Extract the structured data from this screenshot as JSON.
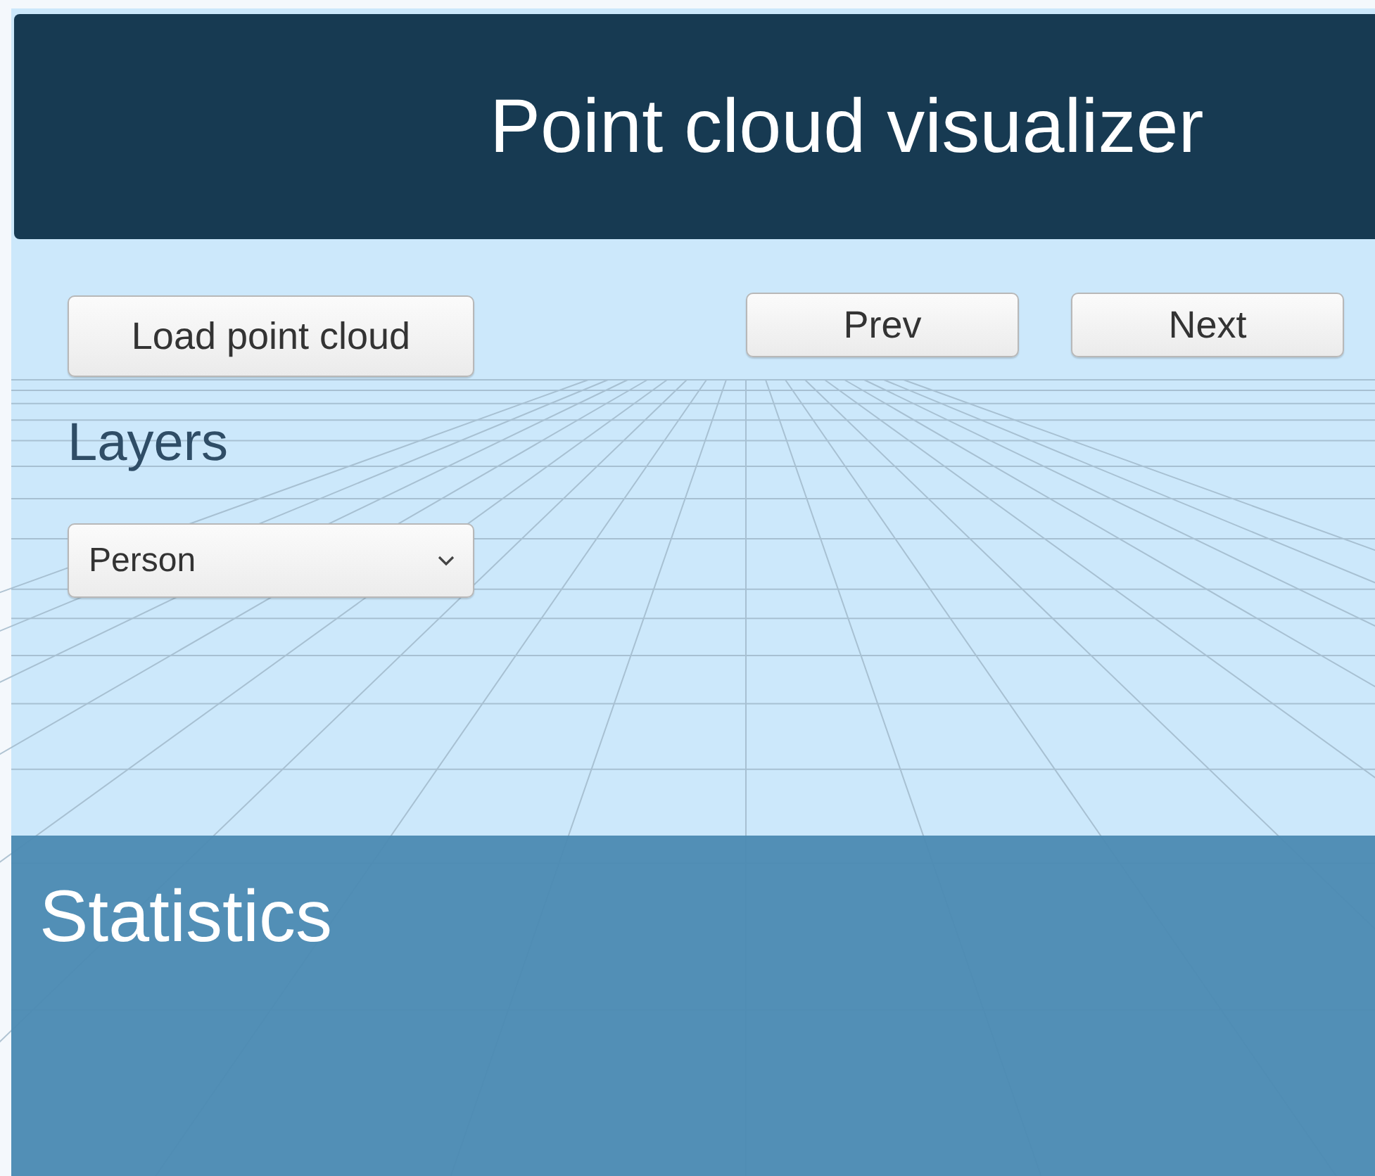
{
  "window": {
    "title": "Point cloud visualizer"
  },
  "load_button": {
    "label": "Load point cloud"
  },
  "nav_buttons": [
    {
      "label": "Prev"
    },
    {
      "label": "Next"
    }
  ],
  "layers": {
    "label": "Layers",
    "dropdown": {
      "value": "Person"
    }
  },
  "statistics": {
    "title": "Statistics"
  }
}
